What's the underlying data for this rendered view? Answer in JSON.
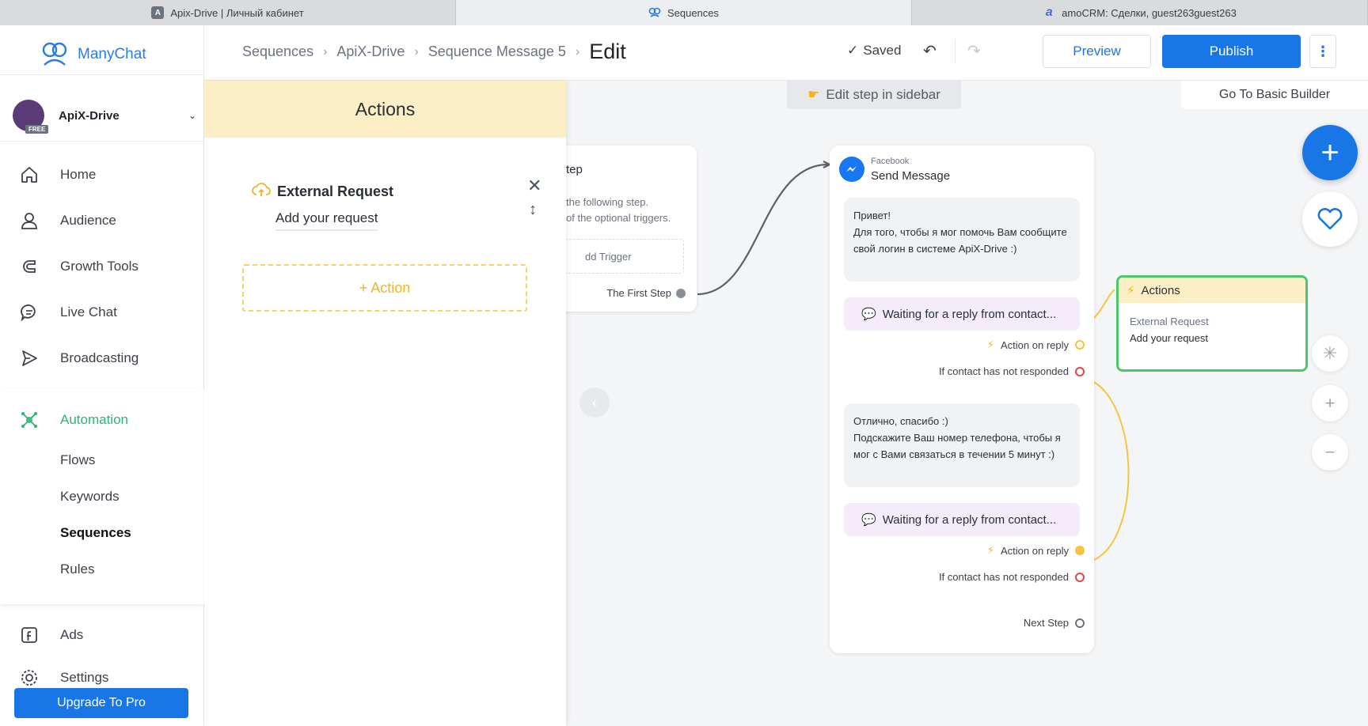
{
  "browser": {
    "tabs": [
      {
        "label": "Apix-Drive | Личный кабинет",
        "icon": "apixdrive-favicon"
      },
      {
        "label": "Sequences",
        "icon": "manychat-favicon"
      },
      {
        "label": "amoCRM: Сделки, guest263guest263",
        "icon": "amocrm-favicon"
      }
    ]
  },
  "sidebar": {
    "brand": "ManyChat",
    "account": {
      "name": "ApiX-Drive",
      "badge": "FREE"
    },
    "nav": [
      {
        "label": "Home",
        "icon": "home-icon"
      },
      {
        "label": "Audience",
        "icon": "user-icon"
      },
      {
        "label": "Growth Tools",
        "icon": "magnet-icon"
      },
      {
        "label": "Live Chat",
        "icon": "chat-icon"
      },
      {
        "label": "Broadcasting",
        "icon": "send-icon"
      }
    ],
    "automation": {
      "label": "Automation",
      "items": [
        "Flows",
        "Keywords",
        "Sequences",
        "Rules"
      ]
    },
    "ads": "Ads",
    "settings": "Settings",
    "upgrade": "Upgrade To Pro"
  },
  "topbar": {
    "breadcrumbs": [
      "Sequences",
      "ApiX-Drive",
      "Sequence Message 5"
    ],
    "current": "Edit",
    "saved": "Saved",
    "preview": "Preview",
    "publish": "Publish"
  },
  "panel": {
    "title": "Actions",
    "action_title": "External Request",
    "action_sub": "Add your request",
    "add_action": "+ Action"
  },
  "canvas": {
    "edit_hint": "Edit step in sidebar",
    "basic_builder": "Go To Basic Builder",
    "start": {
      "title": "tep",
      "desc_1": "the following step.",
      "desc_2": "of the optional triggers.",
      "trigger": "dd Trigger",
      "first_step": "The First Step"
    },
    "message": {
      "source": "Facebook",
      "title": "Send Message",
      "bubble_1": "Привет!\nДля того, чтобы я мог помочь Вам сообщите свой логин в системе ApiX-Drive :)",
      "wait_1": "Waiting for a reply from contact...",
      "action_on_reply_1": "Action on reply",
      "not_responded_1": "If contact has not responded",
      "bubble_2": "Отлично, спасибо :)\nПодскажите Ваш номер телефона, чтобы я мог с Вами связаться в течении 5 минут :)",
      "wait_2": "Waiting for a reply from contact...",
      "action_on_reply_2": "Action on reply",
      "not_responded_2": "If contact has not responded",
      "next_step": "Next Step"
    },
    "actions_node": {
      "title": "Actions",
      "line_1": "External Request",
      "line_2": "Add your request"
    }
  },
  "colors": {
    "brand_blue": "#1976e6",
    "automation_green": "#2bb673",
    "action_yellow": "#fcefc6",
    "node_border_green": "#4cc86a"
  }
}
